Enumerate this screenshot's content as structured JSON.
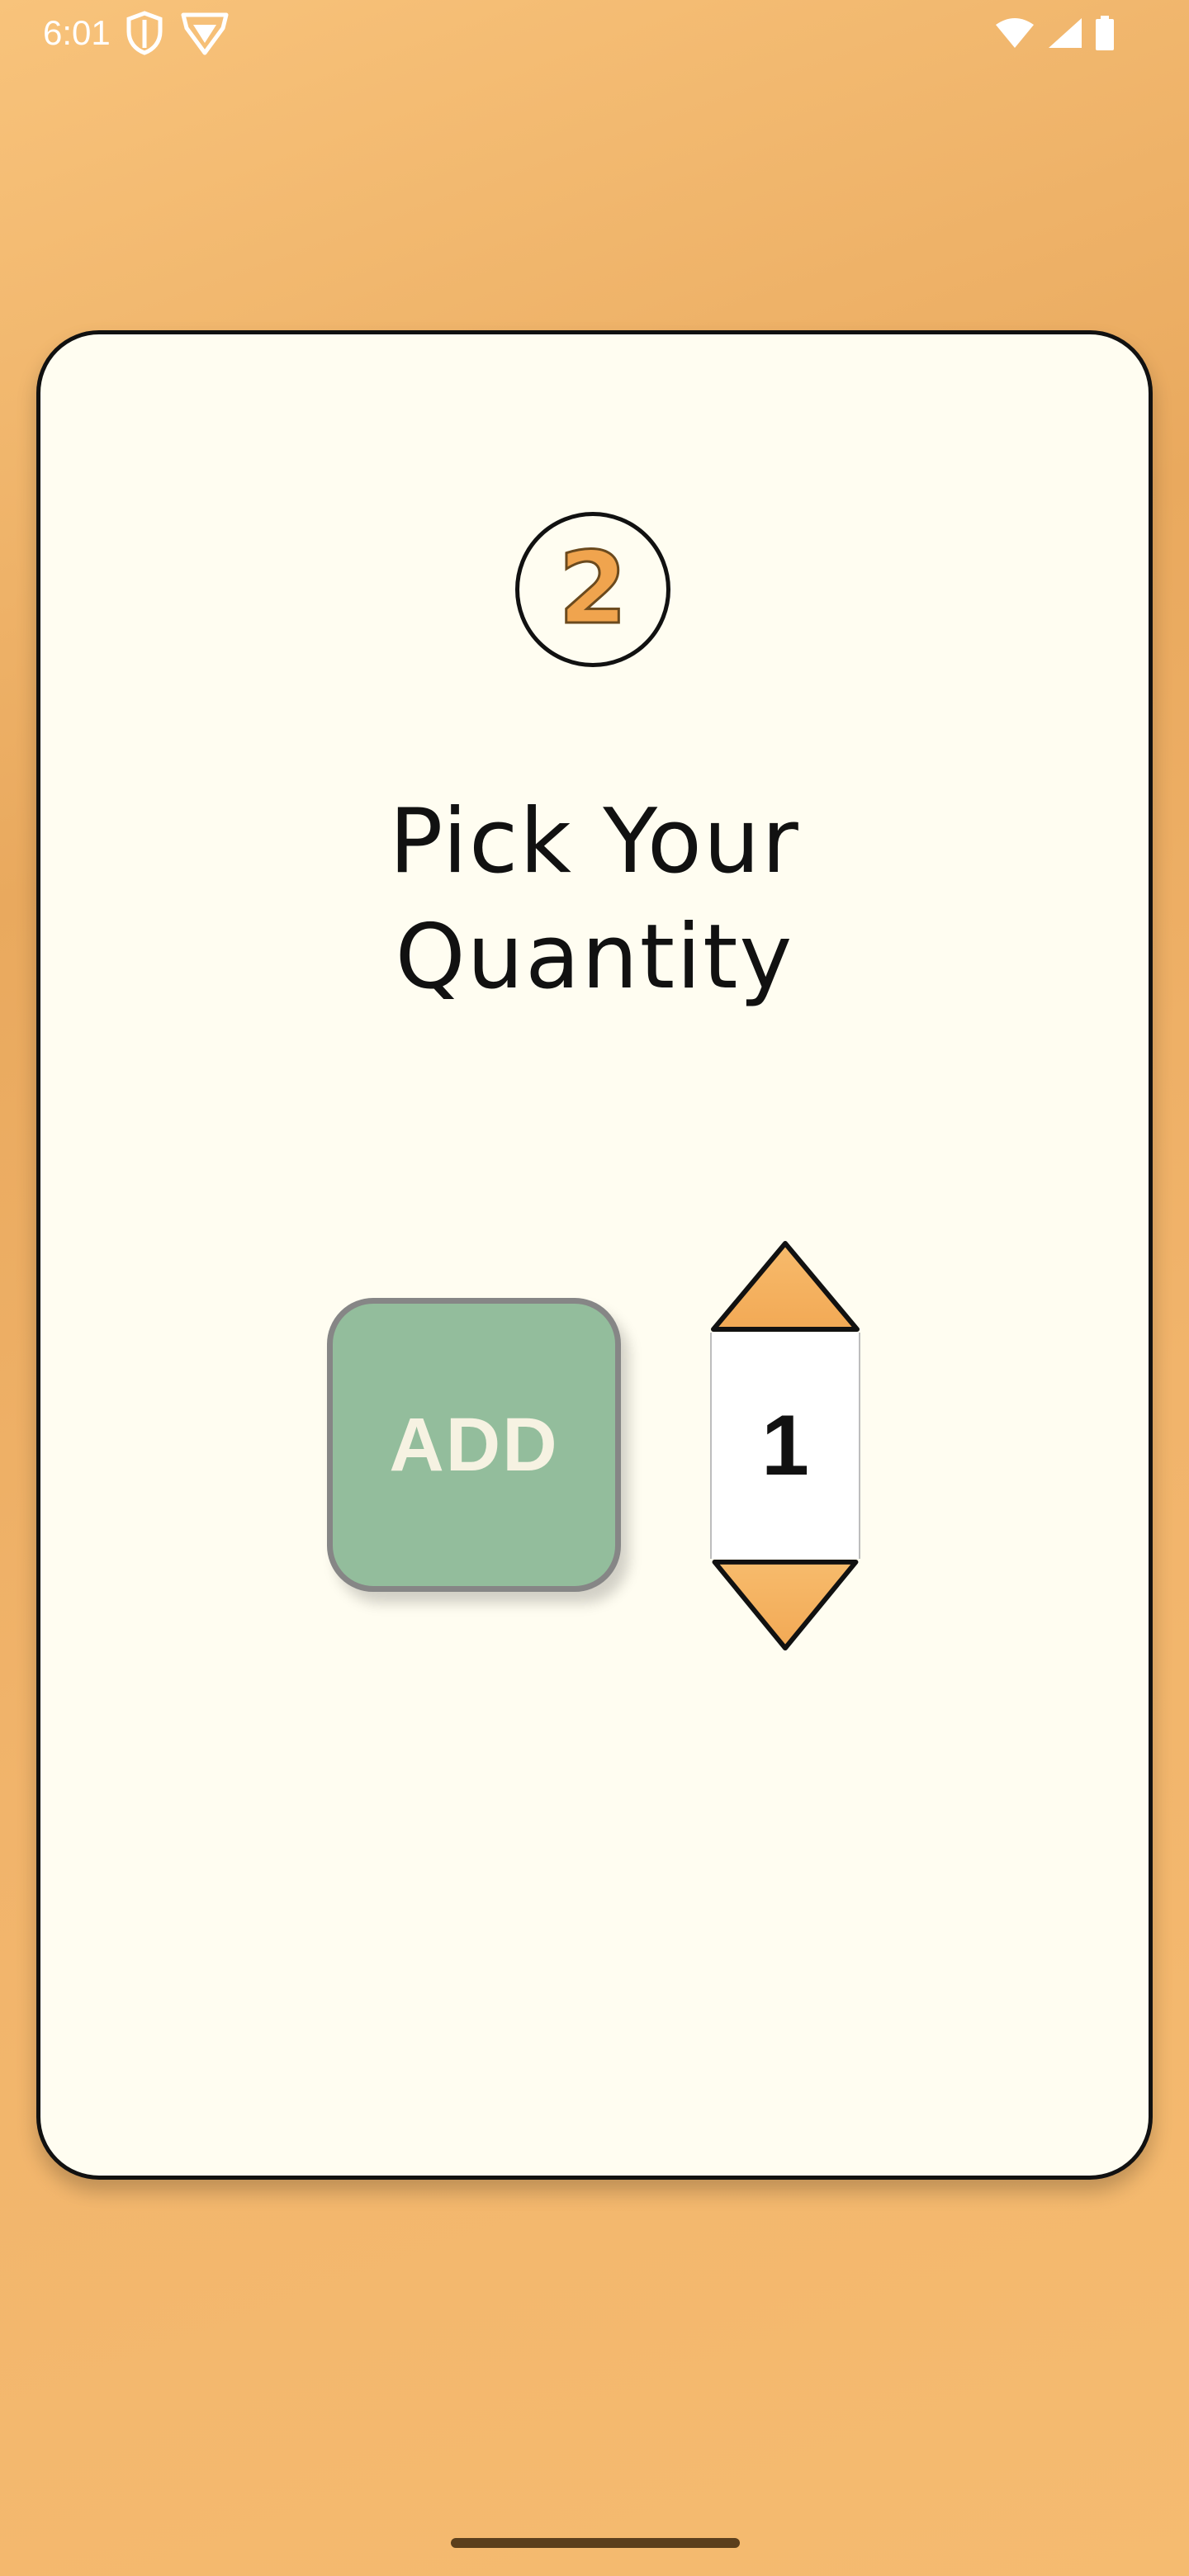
{
  "status_bar": {
    "time": "6:01",
    "left_icons": [
      "shield-icon",
      "vpn-shield-icon"
    ],
    "right_icons": [
      "wifi-icon",
      "cell-signal-icon",
      "battery-icon"
    ]
  },
  "card": {
    "step_number": "2",
    "title_line1": "Pick Your",
    "title_line2": "Quantity",
    "add_button_label": "ADD",
    "quantity": {
      "value": "1",
      "increment_icon": "triangle-up-icon",
      "decrement_icon": "triangle-down-icon"
    }
  },
  "colors": {
    "background": "#eaa95d",
    "card": "#fffdf1",
    "add_button": "#93bd9c",
    "stepper_arrow": "#f5b15e",
    "step_number": "#f0a44e"
  }
}
